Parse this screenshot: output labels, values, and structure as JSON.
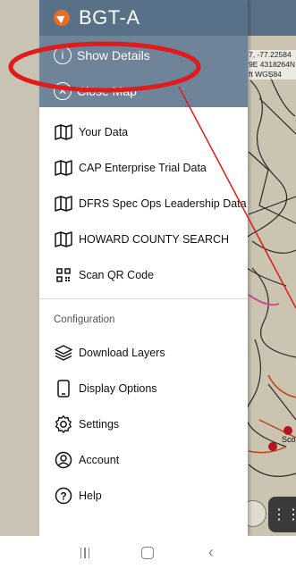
{
  "app": {
    "title": "BGT-A"
  },
  "header": {
    "show_details": "Show Details",
    "close_map": "Close Map"
  },
  "map": {
    "coord_line1": "7, -77.22584",
    "coord_line2": "9E 4318264N",
    "coord_line3": "ft  WGS84",
    "place_label": "Sco"
  },
  "menu": {
    "items": [
      {
        "label": "Your Data",
        "icon": "map-icon"
      },
      {
        "label": "CAP Enterprise Trial Data",
        "icon": "map-icon"
      },
      {
        "label": "DFRS Spec Ops Leadership Data",
        "icon": "map-icon"
      },
      {
        "label": "HOWARD COUNTY SEARCH",
        "icon": "map-icon"
      },
      {
        "label": "Scan QR Code",
        "icon": "qr-code-icon"
      }
    ],
    "config_label": "Configuration",
    "config_items": [
      {
        "label": "Download Layers",
        "icon": "layers-icon"
      },
      {
        "label": "Display Options",
        "icon": "phone-icon"
      },
      {
        "label": "Settings",
        "icon": "gear-icon"
      },
      {
        "label": "Account",
        "icon": "account-icon"
      },
      {
        "label": "Help",
        "icon": "help-icon"
      }
    ]
  },
  "colors": {
    "header_bg": "#587189",
    "header_sub_bg": "#6f8399",
    "brand_accent": "#e86d23",
    "annotation": "#e01b1b"
  }
}
